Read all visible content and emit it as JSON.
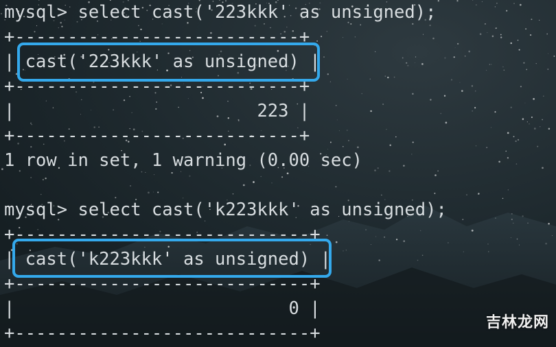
{
  "terminal": {
    "queries": [
      {
        "prompt_line": "mysql> select cast('223kkk' as unsigned);",
        "border_top": "+---------------------------+",
        "header": "| cast('223kkk' as unsigned) |",
        "border_mid": "+---------------------------+",
        "value_row": "|                       223 |",
        "border_bottom": "+---------------------------+",
        "status": "1 row in set, 1 warning (0.00 sec)"
      },
      {
        "prompt_line": "mysql> select cast('k223kkk' as unsigned);",
        "border_top": "+----------------------------+",
        "header": "| cast('k223kkk' as unsigned) |",
        "border_mid": "+----------------------------+",
        "value_row": "|                          0 |",
        "border_bottom": "+----------------------------+"
      }
    ]
  },
  "watermark": "吉林龙网",
  "colors": {
    "highlight": "#34a9ec",
    "text": "#d8dde0",
    "background": "#1c262b"
  }
}
